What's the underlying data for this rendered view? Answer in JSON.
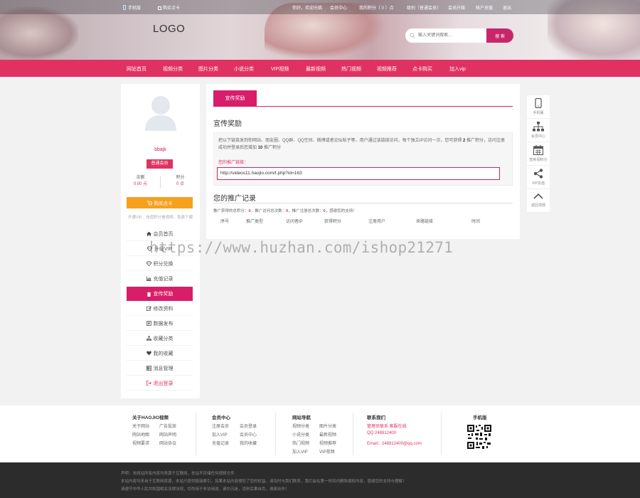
{
  "header": {
    "topbar": {
      "mobile_link": "手机版",
      "buy_card_link": "购买点卡",
      "welcome": "你好，欢迎光临",
      "member_center": "会员中心",
      "points": "我的积分（ 0 ）点",
      "level": "级别（普通会员）",
      "vip_upgrade": "会员升级",
      "recharge": "帐户充值",
      "logout": "退出"
    },
    "logo": "LOGO",
    "search": {
      "placeholder": "输入关键词搜索...",
      "button": "搜 索"
    }
  },
  "nav": {
    "items": [
      "网站首页",
      "视频分类",
      "图片分类",
      "小说分类",
      "VIP视频",
      "最新视频",
      "热门视频",
      "视频推荐",
      "点卡购买",
      "加入vip"
    ]
  },
  "sidebar": {
    "username": "bbajk",
    "member_level": "普通会员",
    "balance_label": "余额",
    "balance_value": "0.00 元",
    "points_label": "积分",
    "points_value": "0 点",
    "buy_button": "购买点卡",
    "buy_note": "开通VIP、充值积分看视频、免费下载",
    "menu": [
      {
        "label": "会员首页",
        "icon": "home-icon"
      },
      {
        "label": "升级VIP",
        "icon": "diamond-icon"
      },
      {
        "label": "积分兑换",
        "icon": "diamond-icon"
      },
      {
        "label": "充值记录",
        "icon": "chart-icon"
      },
      {
        "label": "宣传奖励",
        "icon": "trash-icon"
      },
      {
        "label": "修改资料",
        "icon": "edit-icon"
      },
      {
        "label": "数据发布",
        "icon": "file-icon"
      },
      {
        "label": "收藏分类",
        "icon": "sitemap-icon"
      },
      {
        "label": "我的收藏",
        "icon": "heart-icon"
      },
      {
        "label": "消息管理",
        "icon": "message-icon"
      },
      {
        "label": "退出登录",
        "icon": "logout-icon"
      }
    ]
  },
  "main": {
    "tab": "宣传奖励",
    "section_title": "宣传奖励",
    "promo_text_1": "把以下链接发到你网站、朋友圈、QQ群、QQ空间、微博或者论坛帖子等，用户通过该链接访问，每个独立IP访问一次，您可获得",
    "promo_points": "2",
    "promo_text_2": "推广积分，访问注册成功并登录后您增加",
    "promo_reg_points": "10",
    "promo_text_3": "推广积分",
    "link_label": "您的推广链接：",
    "link_value": "http://videos11.haojio.com/t.php?id=163",
    "records_title": "您的推广记录",
    "summary_1": "推广获得的总积分：",
    "summary_total": "0",
    "summary_2": "，推广访问总次数：",
    "summary_visits": "0",
    "summary_3": "，推广注册总次数：",
    "summary_regs": "0",
    "summary_4": "，感谢您的支持！",
    "table_headers": [
      "序号",
      "推广类型",
      "访问者IP",
      "获得积分",
      "注册用户",
      "来路链接",
      "时间"
    ]
  },
  "floatbar": {
    "items": [
      {
        "label": "手机版",
        "icon": "mobile-icon"
      },
      {
        "label": "会员中心",
        "icon": "sitemap-icon"
      },
      {
        "label": "签到领积分",
        "icon": "calendar-icon"
      },
      {
        "label": "VIP充值",
        "icon": "share-icon"
      },
      {
        "label": "返回顶部",
        "icon": "chevron-up-icon"
      }
    ]
  },
  "watermark": "https://www.huzhan.com/ishop21271",
  "footer": {
    "col1": {
      "title": "关于HAOJIO视频",
      "links": [
        "关于网站",
        "广告投放",
        "网站地图",
        "网站声明",
        "视频要求",
        "网站协议"
      ]
    },
    "col2": {
      "title": "会员中心",
      "links": [
        "注册会员",
        "会员登录",
        "加入VIP",
        "会员中心",
        "充值记录",
        "我的收藏"
      ]
    },
    "col3": {
      "title": "网站导航",
      "links": [
        "视频分类",
        "图片分类",
        "小说分类",
        "最新视频",
        "热门视频",
        "视频推荐",
        "加入VIP",
        "VIP视频"
      ]
    },
    "col4": {
      "title": "联系我们",
      "line1": "管理员联系 客服在线",
      "qq": "QQ:248912400",
      "email": "Email：248912400@qq.com"
    },
    "col5": {
      "title": "手机版"
    }
  },
  "bottom": {
    "line1": "声明：本网站所有内容均来源于互联网，本站不存储任何视频文件",
    "line2": "本站内容均来自于互联网资源，本站只提供链接索引，如果本站内容侵犯了您的权益，请及时与我们联系，我们会在第一时间内删除侵权内容，感谢您的支持与理解！",
    "line3": "请遵守中华人民共和国相关法律法规，切勿用于非法用途，请勿沉迷，否则后果自负，谢谢合作！"
  },
  "colors": {
    "brand": "#e03262",
    "accent": "#d81e68",
    "orange": "#f7a01e"
  }
}
